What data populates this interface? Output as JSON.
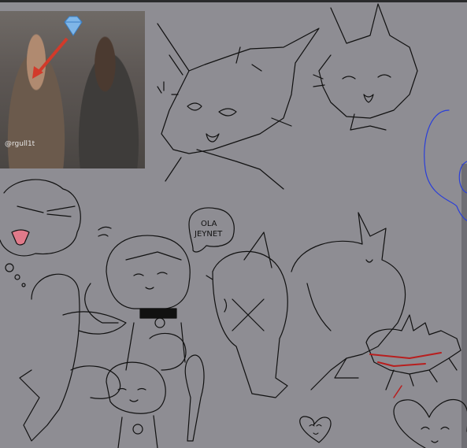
{
  "canvas": {
    "background_color": "#8e8d93"
  },
  "photo": {
    "watermark": "@rgull1t",
    "icon": "diamond-emoji",
    "arrow_color": "#d23a2a"
  },
  "speech_bubble": {
    "line1": "OLA",
    "line2": "JEYNET"
  },
  "colors": {
    "ink": "#111111",
    "blue_stroke": "#2b3fd8",
    "red_tongue": "#e07a8a",
    "red_blood": "#b81e1e"
  }
}
